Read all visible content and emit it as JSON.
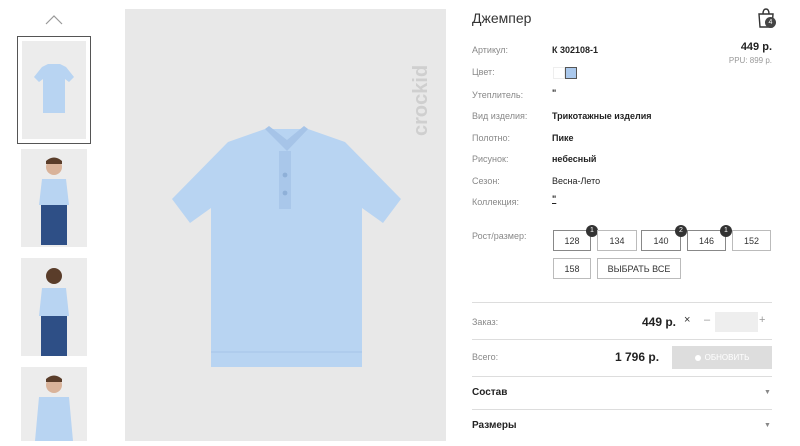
{
  "product": {
    "title": "Джемпер",
    "cart_count": "4",
    "price": "449 р.",
    "ppu": "PPU: 899 р."
  },
  "attributes": [
    {
      "label": "Артикул:",
      "value": "К 302108-1"
    },
    {
      "label": "Цвет:",
      "value": ""
    },
    {
      "label": "Утеплитель:",
      "value": "\""
    },
    {
      "label": "Вид изделия:",
      "value": "Трикотажные изделия"
    },
    {
      "label": "Полотно:",
      "value": "Пике"
    },
    {
      "label": "Рисунок:",
      "value": "небесный"
    },
    {
      "label": "Сезон:",
      "value": "Весна-Лето"
    },
    {
      "label": "Коллекция:",
      "value": "\""
    }
  ],
  "colors": {
    "swatch_white": "#ffffff",
    "swatch_blue": "#aac8ec",
    "polo": "#b8d4f2",
    "accent": "#333333"
  },
  "sizes": {
    "label": "Рост/размер:",
    "options": [
      {
        "size": "128",
        "count": "1"
      },
      {
        "size": "134",
        "count": ""
      },
      {
        "size": "140",
        "count": "2"
      },
      {
        "size": "146",
        "count": "1"
      },
      {
        "size": "152",
        "count": ""
      },
      {
        "size": "158",
        "count": ""
      }
    ],
    "select_all": "ВЫБРАТЬ ВСЕ"
  },
  "order": {
    "label": "Заказ:",
    "price": "449 р.",
    "times": "×",
    "minus": "–",
    "plus": "+",
    "quantity": ""
  },
  "total": {
    "label": "Всего:",
    "value": "1 796 р.",
    "update_label": "ОБНОВИТЬ"
  },
  "accordion": [
    {
      "title": "Состав"
    },
    {
      "title": "Размеры"
    }
  ],
  "brand": "crockid"
}
